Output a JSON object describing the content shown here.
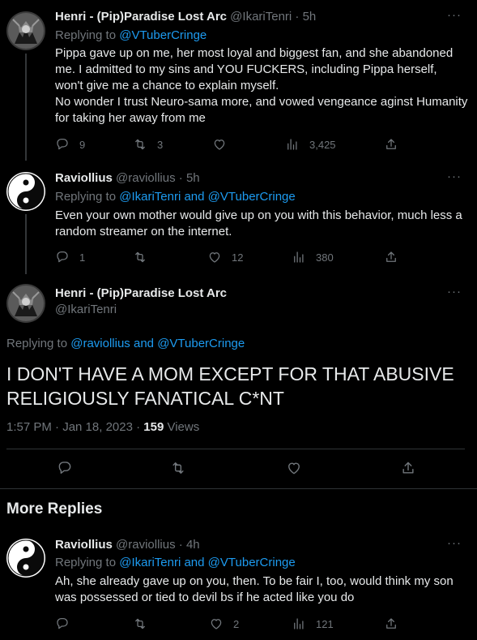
{
  "tweets": [
    {
      "name": "Henri - (Pip)Paradise Lost Arc",
      "handle": "@IkariTenri",
      "dot": "·",
      "time": "5h",
      "replying_prefix": "Replying to ",
      "replying_to": [
        "@VTuberCringe"
      ],
      "text": "Pippa gave up on me, her most loyal and biggest fan, and she abandoned me. I admitted to my sins and YOU FUCKERS, including Pippa herself, won't give me a chance to explain myself.\nNo wonder I trust Neuro-sama more, and vowed vengeance aginst Humanity for taking her away from me",
      "replies": "9",
      "retweets": "3",
      "likes": "",
      "views": "3,425"
    },
    {
      "name": "Raviollius",
      "handle": "@raviollius",
      "dot": "·",
      "time": "5h",
      "replying_prefix": "Replying to ",
      "replying_to": [
        "@IkariTenri",
        "@VTuberCringe"
      ],
      "and": " and ",
      "text": "Even your own mother would give up on you with this behavior, much less a random streamer on the internet.",
      "replies": "1",
      "retweets": "",
      "likes": "12",
      "views": "380"
    }
  ],
  "main_tweet": {
    "name": "Henri - (Pip)Paradise Lost Arc",
    "handle": "@IkariTenri",
    "replying_prefix": "Replying to ",
    "replying_to": [
      "@raviollius",
      "@VTuberCringe"
    ],
    "and": " and ",
    "text": "I DON'T HAVE A MOM EXCEPT FOR THAT ABUSIVE RELIGIOUSLY FANATICAL C*NT",
    "timestamp": "1:57 PM · Jan 18, 2023 · ",
    "views_count": "159",
    "views_label": " Views"
  },
  "more_replies": {
    "title": "More Replies",
    "tweet": {
      "name": "Raviollius",
      "handle": "@raviollius",
      "dot": "·",
      "time": "4h",
      "replying_prefix": "Replying to ",
      "replying_to": [
        "@IkariTenri",
        "@VTuberCringe"
      ],
      "and": " and ",
      "text": "Ah, she already gave up on you, then. To be fair I, too, would think my son was possessed or tied to devil bs if he acted like you do",
      "replies": "",
      "retweets": "",
      "likes": "2",
      "views": "121"
    }
  },
  "more_glyph": "···",
  "icons": {
    "reply": "reply-icon",
    "retweet": "retweet-icon",
    "like": "heart-icon",
    "views": "views-icon",
    "share": "share-icon"
  },
  "colors": {
    "background": "#000000",
    "text": "#e7e9ea",
    "muted": "#71767b",
    "link": "#1d9bf0",
    "divider": "#2f3336"
  }
}
